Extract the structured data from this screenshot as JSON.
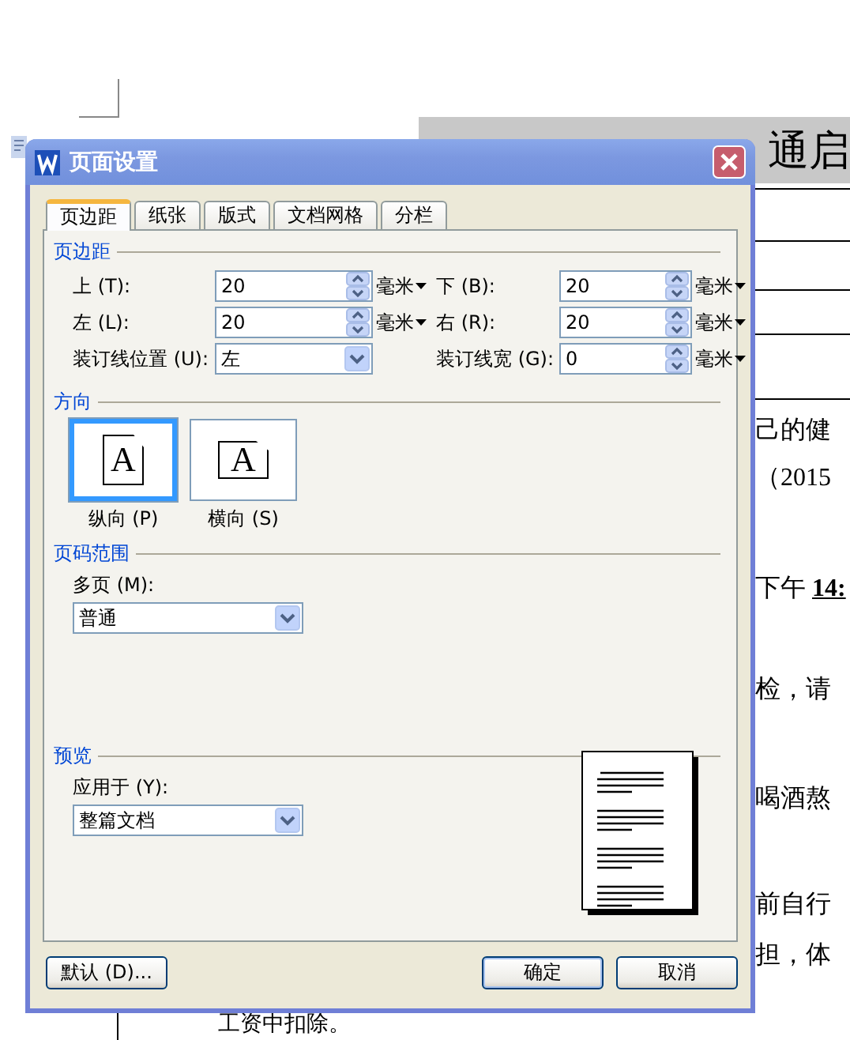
{
  "document": {
    "heading": "通启",
    "lines": [
      "己的健",
      "（2015",
      "下午 **14:**",
      "检，请",
      "喝酒熬",
      "前自行",
      "担，体"
    ],
    "footer_line": "工资中扣除。"
  },
  "dialog": {
    "title": "页面设置",
    "tabs": [
      {
        "label": "页边距",
        "selected": true
      },
      {
        "label": "纸张",
        "selected": false
      },
      {
        "label": "版式",
        "selected": false
      },
      {
        "label": "文档网格",
        "selected": false
      },
      {
        "label": "分栏",
        "selected": false
      }
    ],
    "margins": {
      "legend": "页边距",
      "fields": [
        {
          "label": "上 (T):",
          "kind": "spin",
          "value": "20",
          "unit": "毫米"
        },
        {
          "label": "下 (B):",
          "kind": "spin",
          "value": "20",
          "unit": "毫米"
        },
        {
          "label": "左 (L):",
          "kind": "spin",
          "value": "20",
          "unit": "毫米"
        },
        {
          "label": "右 (R):",
          "kind": "spin",
          "value": "20",
          "unit": "毫米"
        },
        {
          "label": "装订线位置 (U):",
          "kind": "select",
          "value": "左"
        },
        {
          "label": "装订线宽 (G):",
          "kind": "spin",
          "value": "0",
          "unit": "毫米"
        }
      ]
    },
    "orientation": {
      "legend": "方向",
      "options": [
        {
          "label": "纵向 (P)",
          "glyph": "A",
          "kind": "portrait",
          "selected": true
        },
        {
          "label": "横向 (S)",
          "glyph": "A",
          "kind": "landscape",
          "selected": false
        }
      ]
    },
    "page_range": {
      "legend": "页码范围",
      "label": "多页 (M):",
      "value": "普通"
    },
    "preview": {
      "legend": "预览",
      "label": "应用于 (Y):",
      "value": "整篇文档"
    },
    "buttons": [
      {
        "label": "默认 (D)...",
        "kind": "default"
      },
      {
        "label": "确定",
        "kind": "ok"
      },
      {
        "label": "取消",
        "kind": "cancel"
      }
    ]
  }
}
